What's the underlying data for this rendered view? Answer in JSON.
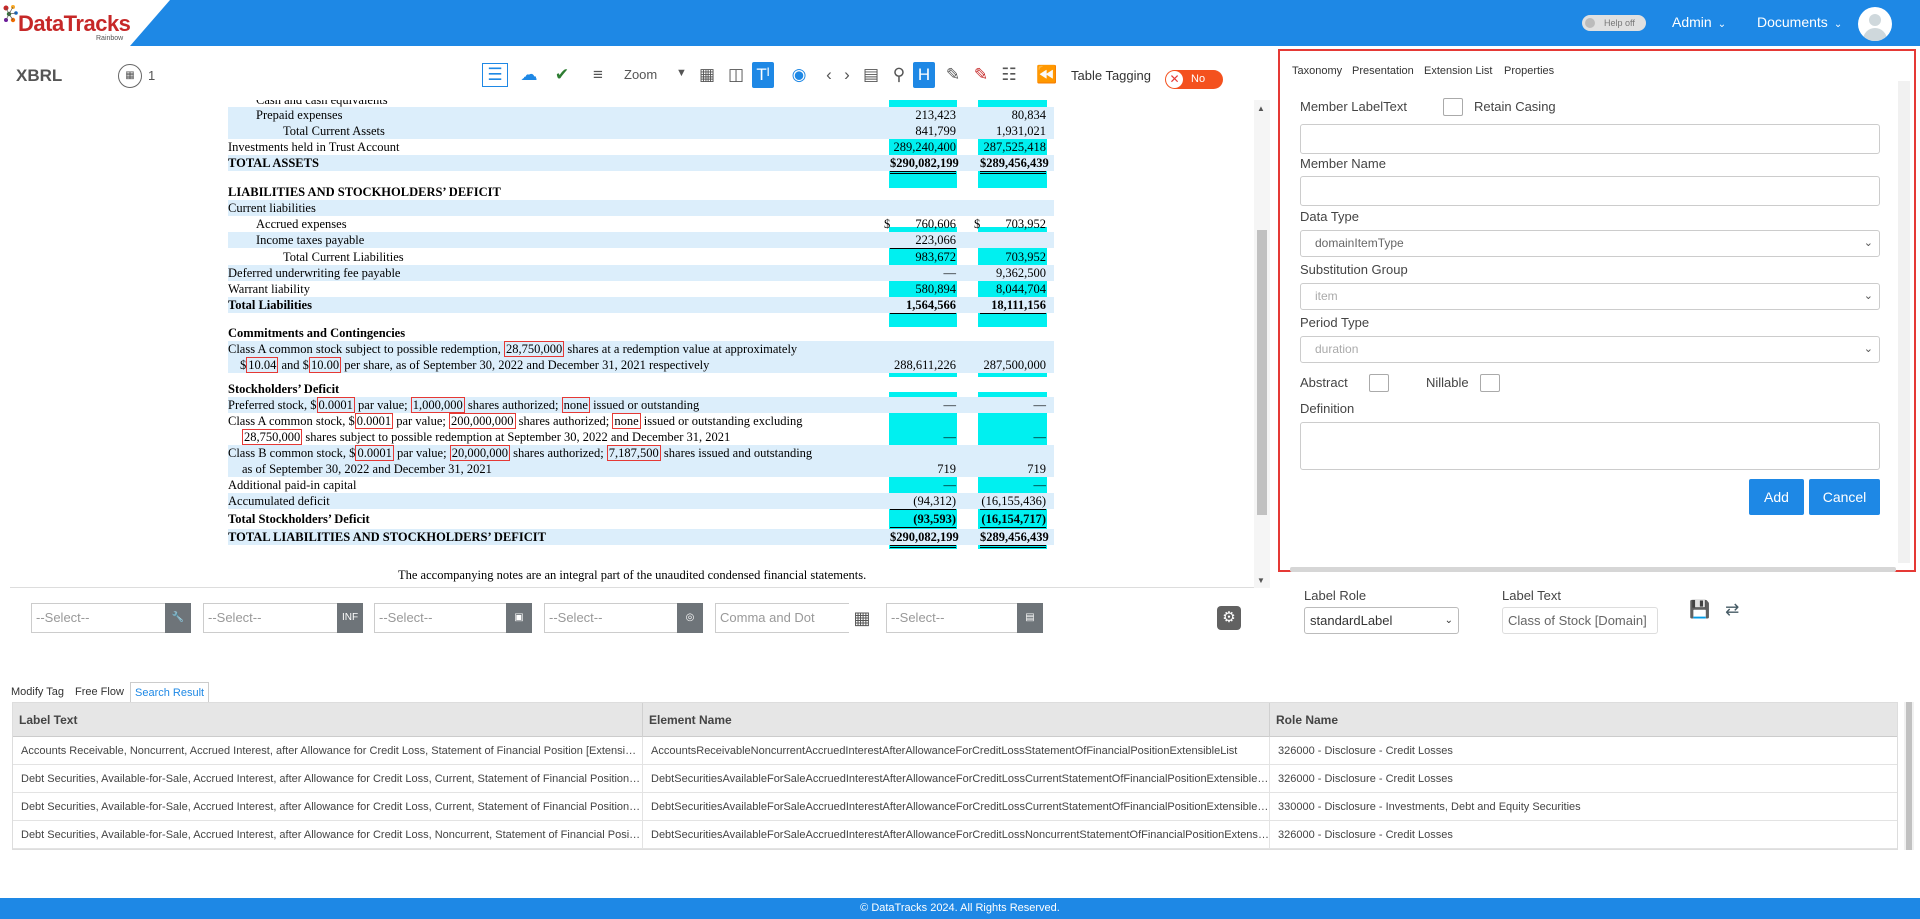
{
  "header": {
    "logo_text": "DataTracks",
    "logo_sub": "Rainbow",
    "help_toggle": "Help off",
    "admin": "Admin",
    "documents": "Documents"
  },
  "toolbar": {
    "title": "XBRL",
    "calc_count": "1",
    "zoom": "Zoom",
    "table_tagging": "Table Tagging",
    "toggle_state": "No"
  },
  "doc": {
    "rows": [
      {
        "label": "Prepaid expenses",
        "c1": "213,423",
        "c2": "80,834"
      },
      {
        "label": "Total Current Assets",
        "c1": "841,799",
        "c2": "1,931,021"
      },
      {
        "label": "Investments held in Trust Account",
        "c1": "289,240,400",
        "c2": "287,525,418"
      },
      {
        "label": "TOTAL ASSETS",
        "c1": "$290,082,199",
        "c2": "$289,456,439"
      },
      {
        "label": "LIABILITIES AND STOCKHOLDERS’ DEFICIT"
      },
      {
        "label": "Current liabilities"
      },
      {
        "label": "Accrued expenses",
        "d1": "$",
        "c1": "760,606",
        "d2": "$",
        "c2": "703,952"
      },
      {
        "label": "Income taxes payable",
        "c1": "223,066",
        "c2": ""
      },
      {
        "label": "Total Current Liabilities",
        "c1": "983,672",
        "c2": "703,952"
      },
      {
        "label": "Deferred underwriting fee payable",
        "c1": "—",
        "c2": "9,362,500"
      },
      {
        "label": "Warrant liability",
        "c1": "580,894",
        "c2": "8,044,704"
      },
      {
        "label": "Total Liabilities",
        "c1": "1,564,566",
        "c2": "18,111,156"
      },
      {
        "label": "Commitments and Contingencies"
      },
      {
        "label_a": "Class A common stock subject to possible redemption, ",
        "tag_a": "28,750,000",
        "label_b": " shares at a redemption value at approximately"
      },
      {
        "pre": "$",
        "tag_a": "10.04",
        "mid": " and $",
        "tag_b": "10.00",
        "post": " per share, as of September 30, 2022 and December 31, 2021 respectively",
        "c1": "288,611,226",
        "c2": "287,500,000"
      },
      {
        "label": "Stockholders’ Deficit"
      },
      {
        "p1": "Preferred stock, $",
        "t1": "0.0001",
        "p2": " par value; ",
        "t2": "1,000,000",
        "p3": " shares authorized; ",
        "t3": "none",
        "p4": " issued or outstanding",
        "c1": "—",
        "c2": "—"
      },
      {
        "p1": "Class A common stock, $",
        "t1": "0.0001",
        "p2": " par value; ",
        "t2": "200,000,000",
        "p3": " shares authorized; ",
        "t3": "none",
        "p4": " issued or outstanding excluding"
      },
      {
        "tag_a": "28,750,000",
        "post": " shares subject to possible redemption at September 30, 2022 and December 31, 2021",
        "c1": "—",
        "c2": "—"
      },
      {
        "p1": "Class B common stock, $",
        "t1": "0.0001",
        "p2": " par value; ",
        "t2": "20,000,000",
        "p3": " shares authorized; ",
        "t3": "7,187,500",
        "p4": " shares issued and outstanding"
      },
      {
        "label": "as of September 30, 2022 and December 31, 2021",
        "c1": "719",
        "c2": "719"
      },
      {
        "label": "Additional paid-in capital",
        "c1": "—",
        "c2": "—"
      },
      {
        "label": "Accumulated deficit",
        "c1": "(94,312)",
        "c2": "(16,155,436)"
      },
      {
        "label": "Total Stockholders’ Deficit",
        "c1": "(93,593)",
        "c2": "(16,154,717)"
      },
      {
        "label": "TOTAL LIABILITIES AND STOCKHOLDERS’ DEFICIT",
        "c1": "$290,082,199",
        "c2": "$289,456,439"
      }
    ],
    "top_partial_label": "Cash and cash equivalents",
    "note": "The accompanying notes are an integral part of the unaudited condensed financial statements."
  },
  "filters": {
    "select1": "--Select--",
    "select2": "--Select--",
    "select2_btn": "INF",
    "select3": "--Select--",
    "select4": "--Select--",
    "format": "Comma and Dot",
    "select6": "--Select--"
  },
  "panel": {
    "tabs": [
      "Taxonomy",
      "Presentation",
      "Extension List",
      "Properties"
    ],
    "member_label": "Member LabelText",
    "retain_casing": "Retain Casing",
    "member_name": "Member Name",
    "data_type_label": "Data Type",
    "data_type_value": "domainItemType",
    "subst_label": "Substitution Group",
    "subst_value": "item",
    "period_label": "Period Type",
    "period_value": "duration",
    "abstract": "Abstract",
    "nillable": "Nillable",
    "definition": "Definition",
    "add": "Add",
    "cancel": "Cancel"
  },
  "label_role": {
    "role_label": "Label Role",
    "role_value": "standardLabel",
    "text_label": "Label Text",
    "text_value": "Class of Stock [Domain]"
  },
  "bottom_tabs": [
    "Modify Tag",
    "Free Flow",
    "Search Result"
  ],
  "table": {
    "columns": [
      "Label Text",
      "Element Name",
      "Role Name"
    ],
    "rows": [
      [
        "Accounts Receivable, Noncurrent, Accrued Interest, after Allowance for Credit Loss, Statement of Financial Position [Extensible List]",
        "AccountsReceivableNoncurrentAccruedInterestAfterAllowanceForCreditLossStatementOfFinancialPositionExtensibleList",
        "326000 - Disclosure - Credit Losses"
      ],
      [
        "Debt Securities, Available-for-Sale, Accrued Interest, after Allowance for Credit Loss, Current, Statement of Financial Position [Extensible List]",
        "DebtSecuritiesAvailableForSaleAccruedInterestAfterAllowanceForCreditLossCurrentStatementOfFinancialPositionExtensibleList",
        "326000 - Disclosure - Credit Losses"
      ],
      [
        "Debt Securities, Available-for-Sale, Accrued Interest, after Allowance for Credit Loss, Current, Statement of Financial Position [Extensible List]",
        "DebtSecuritiesAvailableForSaleAccruedInterestAfterAllowanceForCreditLossCurrentStatementOfFinancialPositionExtensibleList",
        "330000 - Disclosure - Investments, Debt and Equity Securities"
      ],
      [
        "Debt Securities, Available-for-Sale, Accrued Interest, after Allowance for Credit Loss, Noncurrent, Statement of Financial Position [Extensible List]",
        "DebtSecuritiesAvailableForSaleAccruedInterestAfterAllowanceForCreditLossNoncurrentStatementOfFinancialPositionExtensibleList",
        "326000 - Disclosure - Credit Losses"
      ]
    ]
  },
  "footer": "© DataTracks 2024. All Rights Reserved."
}
